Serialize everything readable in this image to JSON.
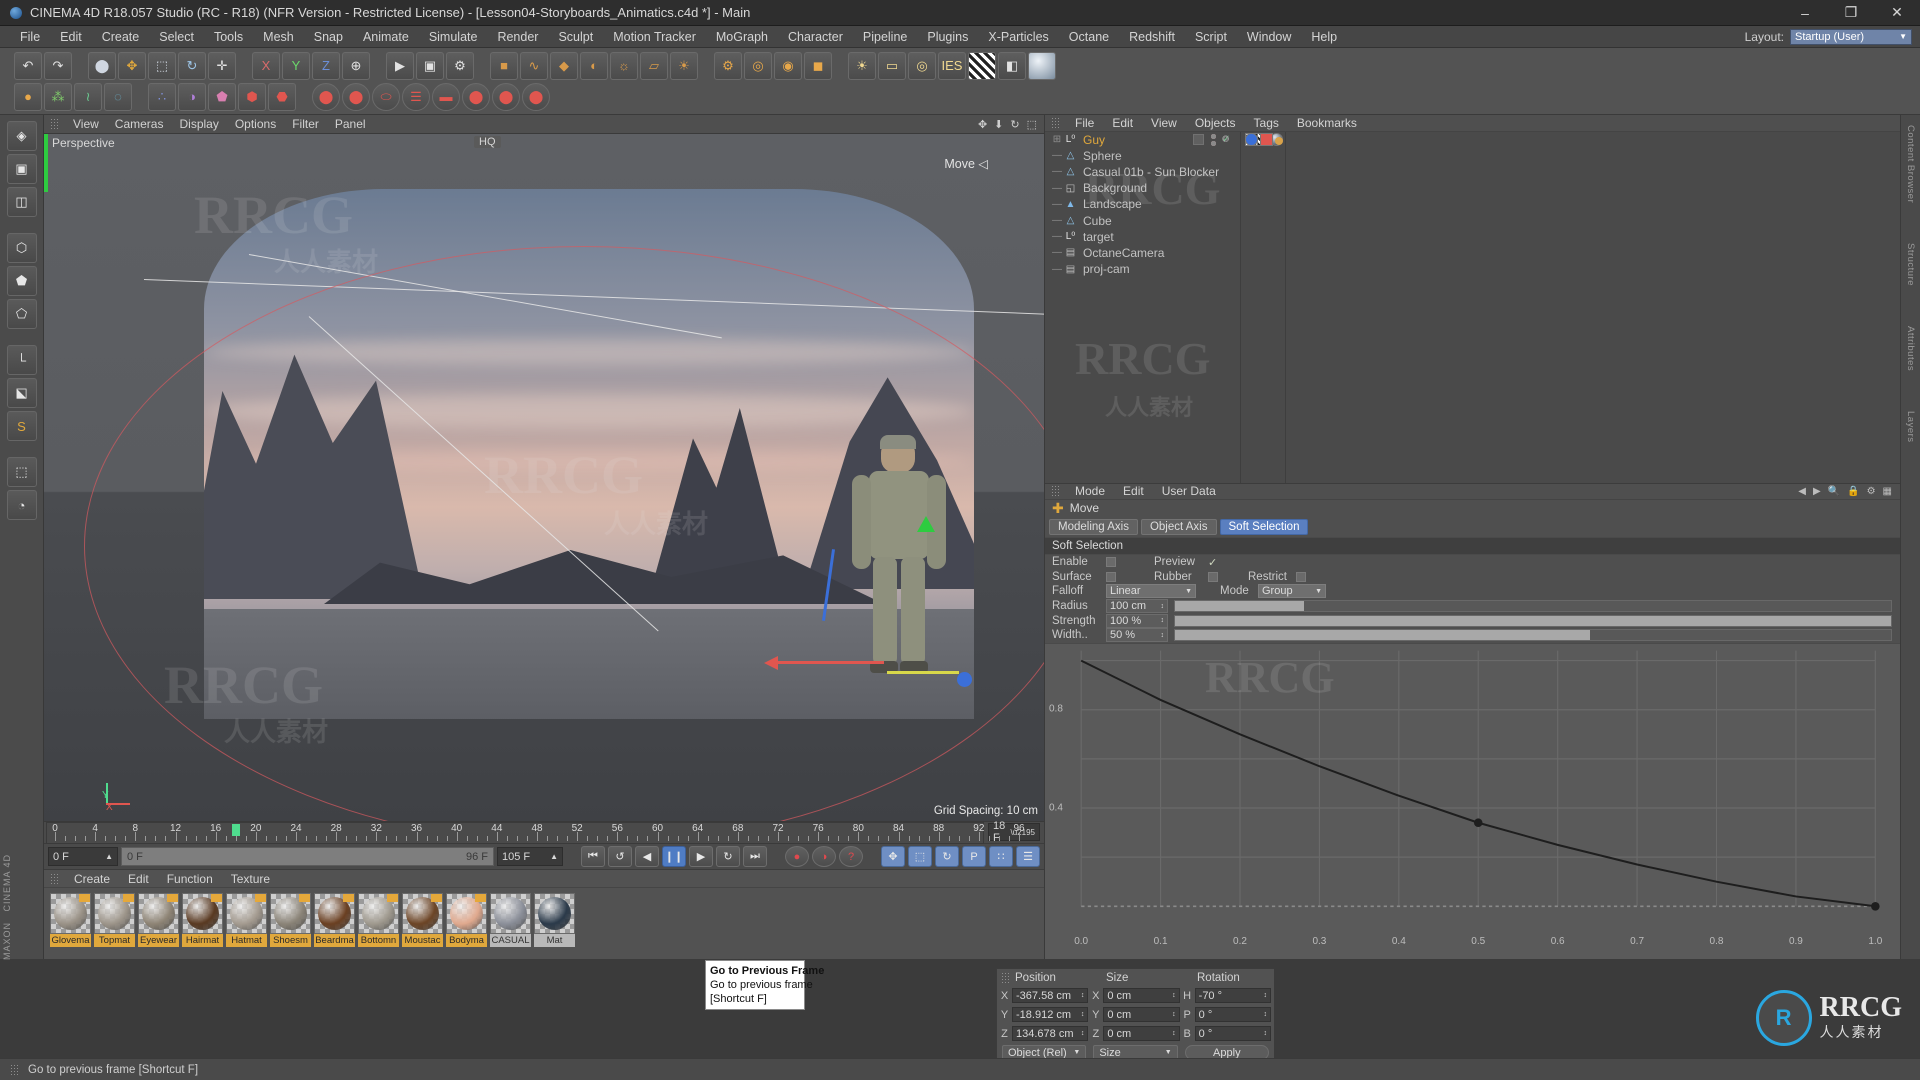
{
  "titlebar": {
    "title": "CINEMA 4D R18.057 Studio (RC - R18) (NFR Version - Restricted License) - [Lesson04-Storyboards_Animatics.c4d *] - Main",
    "minimize": "–",
    "maximize": "❐",
    "close": "✕"
  },
  "menubar": {
    "items": [
      "File",
      "Edit",
      "Create",
      "Select",
      "Tools",
      "Mesh",
      "Snap",
      "Animate",
      "Simulate",
      "Render",
      "Sculpt",
      "Motion Tracker",
      "MoGraph",
      "Character",
      "Pipeline",
      "Plugins",
      "X-Particles",
      "Octane",
      "Redshift",
      "Script",
      "Window",
      "Help"
    ],
    "layout_label": "Layout:",
    "layout_value": "Startup (User)",
    "layout_caret": "▼"
  },
  "toolbar_row1": [
    {
      "name": "undo-button",
      "glyph": "↶"
    },
    {
      "name": "redo-button",
      "glyph": "↷"
    },
    {
      "name": "live-selection-button",
      "glyph": "⬤"
    },
    {
      "name": "move-tool-button",
      "glyph": "✥"
    },
    {
      "name": "scale-tool-button",
      "glyph": "⬚"
    },
    {
      "name": "rotate-tool-button",
      "glyph": "↻"
    },
    {
      "name": "move-axis-button",
      "glyph": "✛"
    },
    {
      "name": "lock-x-button",
      "glyph": "X"
    },
    {
      "name": "lock-y-button",
      "glyph": "Y"
    },
    {
      "name": "lock-z-button",
      "glyph": "Z"
    },
    {
      "name": "world-axis-button",
      "glyph": "⊕"
    },
    {
      "name": "render-view-button",
      "glyph": "▶"
    },
    {
      "name": "render-region-button",
      "glyph": "▣"
    },
    {
      "name": "render-settings-button",
      "glyph": "⚙"
    },
    {
      "name": "cube-primitive-button",
      "glyph": "■"
    },
    {
      "name": "spline-button",
      "glyph": "∿"
    },
    {
      "name": "generator-button",
      "glyph": "◆"
    },
    {
      "name": "deformer-button",
      "glyph": "◐"
    },
    {
      "name": "environment-button",
      "glyph": "☼"
    },
    {
      "name": "camera-button",
      "glyph": "▱"
    },
    {
      "name": "light-button",
      "glyph": "☀"
    },
    {
      "name": "settings-gear-button",
      "glyph": "⚙"
    },
    {
      "name": "octane-render-button",
      "glyph": "◎"
    },
    {
      "name": "octane-settings-button",
      "glyph": "◉"
    },
    {
      "name": "octane-live-button",
      "glyph": "◼"
    },
    {
      "name": "sun-button",
      "glyph": "☀"
    },
    {
      "name": "area-light-button",
      "glyph": "▭"
    },
    {
      "name": "target-light-button",
      "glyph": "◎"
    },
    {
      "name": "ies-light-button",
      "glyph": "IES"
    },
    {
      "name": "checker-button",
      "glyph": "▒"
    },
    {
      "name": "proxy-button",
      "glyph": "◧"
    },
    {
      "name": "material-sphere-button",
      "glyph": "●"
    }
  ],
  "toolbar_row2": [
    {
      "name": "octane-object-button",
      "glyph": "●"
    },
    {
      "name": "scatter-button",
      "glyph": "⁂"
    },
    {
      "name": "hair-button",
      "glyph": "≀"
    },
    {
      "name": "cloth-button",
      "glyph": "◌"
    },
    {
      "name": "mograph-cloner-button",
      "glyph": "∴"
    },
    {
      "name": "effector-button",
      "glyph": "◑"
    },
    {
      "name": "xparticles-emitter-button",
      "glyph": "⬟"
    },
    {
      "name": "xparticles-modifier-button",
      "glyph": "⬢"
    },
    {
      "name": "xparticles-generator-button",
      "glyph": "⬣"
    },
    {
      "name": "redshift-light-button",
      "glyph": "⬤"
    },
    {
      "name": "redshift-camera-button",
      "glyph": "⬤"
    },
    {
      "name": "redshift-sky-button",
      "glyph": "⬭"
    },
    {
      "name": "redshift-proxy-button",
      "glyph": "☰"
    },
    {
      "name": "redshift-dome-button",
      "glyph": "▬"
    },
    {
      "name": "redshift-sun-button",
      "glyph": "⬤"
    },
    {
      "name": "redshift-render-button",
      "glyph": "⬤"
    },
    {
      "name": "redshift-settings-button",
      "glyph": "⬤"
    }
  ],
  "left_tools": [
    {
      "name": "tool-make-editable",
      "glyph": "◈"
    },
    {
      "name": "tool-model-mode",
      "glyph": "▣"
    },
    {
      "name": "tool-texture-mode",
      "glyph": "◫"
    },
    {
      "name": "tool-point-mode",
      "glyph": "⬡"
    },
    {
      "name": "tool-edge-mode",
      "glyph": "⬟"
    },
    {
      "name": "tool-polygon-mode",
      "glyph": "⬠"
    },
    {
      "name": "tool-axis-mode",
      "glyph": "└"
    },
    {
      "name": "tool-lock-axis",
      "glyph": "⬕"
    },
    {
      "name": "tool-snap-mode",
      "glyph": "S"
    },
    {
      "name": "tool-workplane",
      "glyph": "⬚"
    },
    {
      "name": "tool-viewport-solo",
      "glyph": "◔"
    }
  ],
  "viewport": {
    "menu_items": [
      "View",
      "Cameras",
      "Display",
      "Options",
      "Filter",
      "Panel"
    ],
    "perspective_label": "Perspective",
    "hq_label": "HQ",
    "move_label": "Move ◁",
    "grid_label": "Grid Spacing: 10 cm",
    "corner_icons": [
      "✥",
      "⬇",
      "↻",
      "⬚"
    ]
  },
  "timeline": {
    "ticks": [
      "0",
      "4",
      "8",
      "12",
      "16",
      "20",
      "24",
      "28",
      "32",
      "36",
      "40",
      "44",
      "48",
      "52",
      "56",
      "60",
      "64",
      "68",
      "72",
      "76",
      "80",
      "84",
      "88",
      "92",
      "96"
    ],
    "playhead_frame": 18,
    "end_field": "18 F",
    "start_field": "0 F",
    "range_start": "0 F",
    "range_end": "96 F",
    "total_field": "105 F"
  },
  "playback": {
    "buttons": [
      {
        "name": "go-to-start-button",
        "glyph": "⏮"
      },
      {
        "name": "go-to-previous-key-button",
        "glyph": "↺"
      },
      {
        "name": "go-to-previous-frame-button",
        "glyph": "◀"
      },
      {
        "name": "play-pause-button",
        "glyph": "❙❙"
      },
      {
        "name": "play-forward-button",
        "glyph": "▶"
      },
      {
        "name": "go-to-next-key-button",
        "glyph": "↻"
      },
      {
        "name": "go-to-end-button",
        "glyph": "⏭"
      }
    ],
    "record_buttons": [
      {
        "name": "record-active-objects-button",
        "glyph": "●"
      },
      {
        "name": "autokeying-button",
        "glyph": "◑"
      },
      {
        "name": "keyframe-selection-button",
        "glyph": "?"
      }
    ],
    "key_toggles": [
      {
        "name": "position-key-button",
        "glyph": "✥"
      },
      {
        "name": "scale-key-button",
        "glyph": "⬚"
      },
      {
        "name": "rotation-key-button",
        "glyph": "↻"
      },
      {
        "name": "parameter-key-button",
        "glyph": "P"
      },
      {
        "name": "point-level-animation-button",
        "glyph": "∷"
      }
    ],
    "timeline-toggle": {
      "name": "timeline-button",
      "glyph": "☰"
    }
  },
  "material_manager": {
    "menu_items": [
      "Create",
      "Edit",
      "Function",
      "Texture"
    ],
    "materials": [
      {
        "name": "Glovema",
        "color": "#9a9287",
        "tagged": true
      },
      {
        "name": "Topmat",
        "color": "#9d958a",
        "tagged": true
      },
      {
        "name": "Eyewear",
        "color": "#8e8475",
        "tagged": true
      },
      {
        "name": "Hairmat",
        "color": "#5a3a22",
        "tagged": true
      },
      {
        "name": "Hatmat",
        "color": "#a49b90",
        "tagged": true
      },
      {
        "name": "Shoesm",
        "color": "#8b8478",
        "tagged": true
      },
      {
        "name": "Beardma",
        "color": "#6b4022",
        "tagged": true
      },
      {
        "name": "Bottomn",
        "color": "#9f998e",
        "tagged": true
      },
      {
        "name": "Moustac",
        "color": "#6d4526",
        "tagged": true
      },
      {
        "name": "Bodyma",
        "color": "#e0a98e",
        "tagged": true
      },
      {
        "name": "CASUAL",
        "color": "#8b8f99",
        "tagged": false
      },
      {
        "name": "Mat",
        "color": "#2b3a4a",
        "tagged": false
      }
    ]
  },
  "object_manager": {
    "menu_items": [
      "File",
      "Edit",
      "View",
      "Objects",
      "Tags",
      "Bookmarks"
    ],
    "objects": [
      {
        "label": "Guy",
        "icon": "null-icon",
        "glyph": "L⁰",
        "selected": true,
        "expandable": true,
        "tags": []
      },
      {
        "label": "Sphere",
        "icon": "polygon-icon",
        "glyph": "△",
        "selected": false,
        "expandable": false,
        "tags": [
          "phong",
          "checker",
          "material"
        ]
      },
      {
        "label": "Casual 01b - Sun Blocker",
        "icon": "polygon-icon",
        "glyph": "△",
        "selected": false,
        "expandable": false,
        "tags": [
          "checker",
          "uv",
          "phong"
        ]
      },
      {
        "label": "Background",
        "icon": "background-icon",
        "glyph": "◱",
        "selected": false,
        "expandable": false,
        "tags": [
          "material"
        ]
      },
      {
        "label": "Landscape",
        "icon": "landscape-icon",
        "glyph": "▲",
        "selected": false,
        "expandable": false,
        "tags": [
          "phong"
        ]
      },
      {
        "label": "Cube",
        "icon": "polygon-icon",
        "glyph": "△",
        "selected": false,
        "expandable": false,
        "tags": [
          "phong"
        ]
      },
      {
        "label": "target",
        "icon": "null-icon",
        "glyph": "L⁰",
        "selected": false,
        "expandable": false,
        "tags": []
      },
      {
        "label": "OctaneCamera",
        "icon": "camera-icon",
        "glyph": "▤",
        "selected": false,
        "expandable": false,
        "tags": [
          "octane-target",
          "octane-cam"
        ]
      },
      {
        "label": "proj-cam",
        "icon": "camera-icon",
        "glyph": "▤",
        "selected": false,
        "expandable": false,
        "tags": []
      }
    ]
  },
  "attributes": {
    "menu_items": [
      "Mode",
      "Edit",
      "User Data"
    ],
    "mode_label": "Move",
    "tabs": [
      {
        "label": "Modeling Axis",
        "active": false
      },
      {
        "label": "Object Axis",
        "active": false
      },
      {
        "label": "Soft Selection",
        "active": true
      }
    ],
    "section_title": "Soft Selection",
    "rows": {
      "enable_label": "Enable",
      "enable_checked": false,
      "preview_label": "Preview",
      "preview_checked": true,
      "surface_label": "Surface",
      "surface_checked": false,
      "rubber_label": "Rubber",
      "rubber_checked": false,
      "restrict_label": "Restrict",
      "restrict_checked": false,
      "falloff_label": "Falloff",
      "falloff_value": "Linear",
      "mode_label": "Mode",
      "mode_value": "Group",
      "radius_label": "Radius",
      "radius_value": "100 cm",
      "strength_label": "Strength",
      "strength_value": "100 %",
      "width_label": "Width..",
      "width_value": "50 %"
    }
  },
  "chart_data": {
    "type": "line",
    "title": "",
    "x": [
      0.0,
      0.1,
      0.2,
      0.3,
      0.4,
      0.5,
      0.6,
      0.7,
      0.8,
      0.9,
      1.0
    ],
    "values": [
      1.0,
      0.84,
      0.7,
      0.57,
      0.45,
      0.34,
      0.25,
      0.17,
      0.1,
      0.04,
      0.0
    ],
    "xticks": [
      "0.0",
      "0.1",
      "0.2",
      "0.3",
      "0.4",
      "0.5",
      "0.6",
      "0.7",
      "0.8",
      "0.9",
      "1.0"
    ],
    "yticks": [
      "0.4",
      "0.8"
    ],
    "xlabel": "",
    "ylabel": "",
    "xlim": [
      0.0,
      1.0
    ],
    "ylim": [
      0.0,
      1.0
    ],
    "grid": true,
    "points": [
      {
        "x": 0.5,
        "y": 0.34
      },
      {
        "x": 1.0,
        "y": 0.0
      }
    ]
  },
  "coordinates": {
    "headers": [
      "Position",
      "Size",
      "Rotation"
    ],
    "rows": [
      {
        "pos_axis": "X",
        "pos_value": "-367.58 cm",
        "size_axis": "X",
        "size_value": "0 cm",
        "rot_axis": "H",
        "rot_value": "-70 °"
      },
      {
        "pos_axis": "Y",
        "pos_value": "-18.912 cm",
        "size_axis": "Y",
        "size_value": "0 cm",
        "rot_axis": "P",
        "rot_value": "0 °"
      },
      {
        "pos_axis": "Z",
        "pos_value": "134.678 cm",
        "size_axis": "Z",
        "size_value": "0 cm",
        "rot_axis": "B",
        "rot_value": "0 °"
      }
    ],
    "object_mode": "Object (Rel)",
    "size_mode": "Size",
    "apply_label": "Apply"
  },
  "tooltip": {
    "title": "Go to Previous Frame",
    "description": "Go to previous frame",
    "shortcut": "[Shortcut F]"
  },
  "statusbar": {
    "text": "Go to previous frame [Shortcut F]"
  },
  "side_strips": {
    "right_labels": [
      "Content Browser",
      "Structure",
      "Attributes",
      "Layers"
    ]
  },
  "branding": {
    "maxon": "MAXON",
    "product": "CINEMA 4D",
    "watermark": "RRCG",
    "watermark_cn": "人人素材",
    "logo_text": "R"
  }
}
